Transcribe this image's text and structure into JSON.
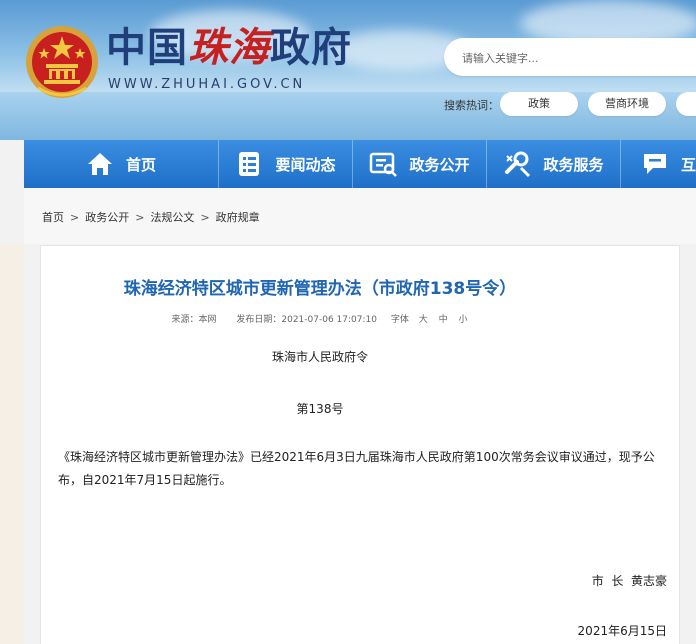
{
  "header": {
    "site_name_part1": "中国",
    "site_name_part2": "珠海",
    "site_name_part3": "政府",
    "domain": "WWW.ZHUHAI.GOV.CN",
    "search_placeholder": "请输入关键字...",
    "hot_label": "搜索热词：",
    "hot_tags": [
      "政策",
      "营商环境"
    ]
  },
  "nav": {
    "items": [
      {
        "label": "首页",
        "icon": "home-icon"
      },
      {
        "label": "要闻动态",
        "icon": "news-icon"
      },
      {
        "label": "政务公开",
        "icon": "disclosure-icon"
      },
      {
        "label": "政务服务",
        "icon": "service-icon"
      },
      {
        "label": "互",
        "icon": "chat-icon"
      }
    ]
  },
  "breadcrumb": [
    "首页",
    "政务公开",
    "法规公文",
    "政府规章"
  ],
  "article": {
    "title": "珠海经济特区城市更新管理办法（市政府138号令）",
    "source_label": "来源：",
    "source": "本网",
    "date_label": "发布日期：",
    "date": "2021-07-06 17:07:10",
    "font_label": "字体",
    "font_sizes": [
      "大",
      "中",
      "小"
    ],
    "issuer": "珠海市人民政府令",
    "number": "第138号",
    "body": "《珠海经济特区城市更新管理办法》已经2021年6月3日九届珠海市人民政府第100次常务会议审议通过，现予公布，自2021年7月15日起施行。",
    "signature": "市  长  黄志豪",
    "sign_date": "2021年6月15日"
  },
  "colors": {
    "nav_blue": "#2a7fd6",
    "title_blue": "#2066b1",
    "brand_red": "#c62020",
    "brand_navy": "#1f3e7a"
  }
}
